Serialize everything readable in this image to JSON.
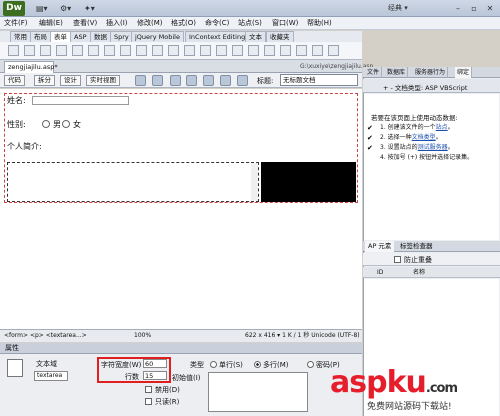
{
  "app": {
    "logo": "Dw",
    "workspace": "经典 ▾"
  },
  "menu": [
    "文件(F)",
    "编辑(E)",
    "查看(V)",
    "插入(I)",
    "修改(M)",
    "格式(O)",
    "命令(C)",
    "站点(S)",
    "窗口(W)",
    "帮助(H)"
  ],
  "insert_tabs": [
    "常用",
    "布局",
    "表单",
    "ASP",
    "数据",
    "Spry",
    "jQuery Mobile",
    "InContext Editing",
    "文本",
    "收藏夹"
  ],
  "document": {
    "tab": "zengjiajilu.asp*",
    "path": "G:\\xuxiye\\zengjiajilu.asp",
    "views": [
      "代码",
      "拆分",
      "设计",
      "实时视图"
    ],
    "title_label": "标题:",
    "title_value": "无标题文档"
  },
  "form": {
    "name_label": "姓名:",
    "sex_label": "性别:",
    "male": "男",
    "female": "女",
    "intro_label": "个人简介:"
  },
  "status": {
    "tagpath": "<form> <p> <textarea...> ",
    "zoom": "100%",
    "dims": "622 x 416 ▾ 1 K / 1 秒 Unicode (UTF-8)"
  },
  "properties": {
    "header": "属性",
    "type_label": "文本域",
    "name_value": "textarea",
    "width_label": "字符宽度(W)",
    "width_value": "60",
    "rows_label": "行数",
    "rows_value": "15",
    "kind_label": "类型",
    "kind_single": "单行(S)",
    "kind_multi": "多行(M)",
    "kind_password": "密码(P)",
    "init_label": "初始值(I)",
    "disabled_label": "禁用(D)",
    "readonly_label": "只读(R)"
  },
  "right_panel": {
    "tabs": [
      "文件",
      "数据库",
      "服务器行为",
      "绑定"
    ],
    "subtitle": "+ - 文档类型: ASP VBScript",
    "intro": "若要在该页面上使用动态数据:",
    "steps": [
      {
        "num": "1.",
        "pre": "创建该文件的一个",
        "link": "站点",
        "post": "。"
      },
      {
        "num": "2.",
        "pre": "选择一种",
        "link": "文档类型",
        "post": "。"
      },
      {
        "num": "3.",
        "pre": "设置站点的",
        "link": "测试服务器",
        "post": "。"
      },
      {
        "num": "4.",
        "pre": "按加号 (+) 按钮并选择记录集。",
        "link": "",
        "post": ""
      }
    ],
    "ap_tabs": [
      "AP 元素",
      "标签检查器"
    ],
    "ap_checkbox": "防止重叠",
    "ap_cols": [
      "ID",
      "名称"
    ]
  },
  "watermark": {
    "main": "aspku",
    "dot": ".com",
    "sub": "免费网站源码下载站!"
  }
}
